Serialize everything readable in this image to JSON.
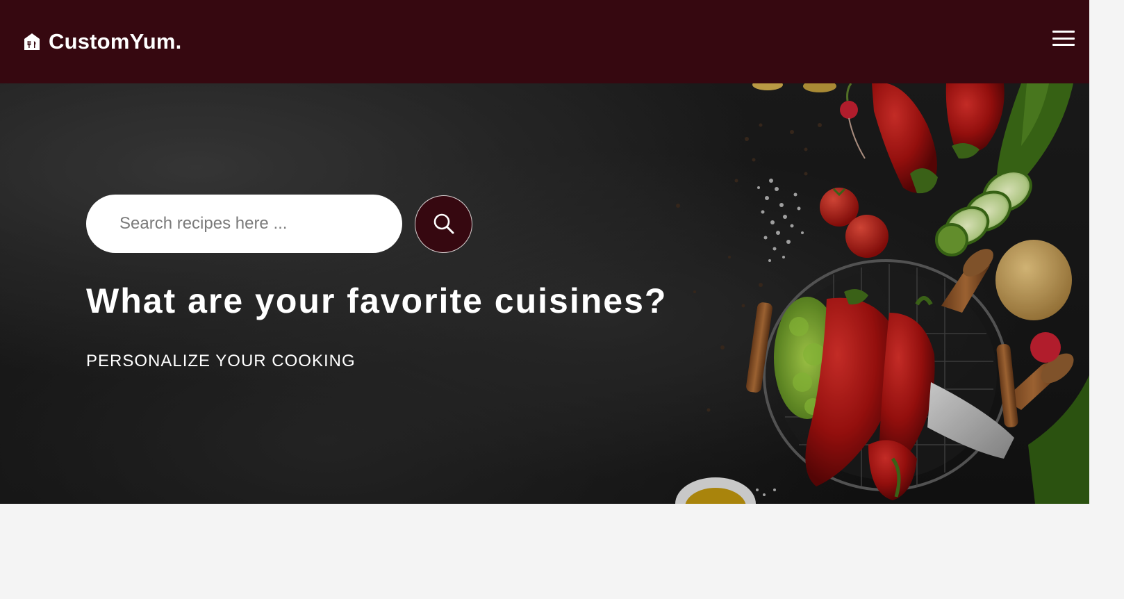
{
  "brand": {
    "name": "CustomYum.",
    "icon": "restaurant-home-icon"
  },
  "header": {
    "menu_icon": "hamburger-menu-icon"
  },
  "search": {
    "placeholder": "Search recipes here ...",
    "value": "",
    "button_icon": "search-icon"
  },
  "hero": {
    "title": "What are your favorite cuisines?",
    "subtitle": "PERSONALIZE YOUR COOKING"
  },
  "colors": {
    "brand": "#360810",
    "hero_background": "#1a1a1a",
    "page_background": "#f4f4f4",
    "text_light": "#ffffff"
  }
}
